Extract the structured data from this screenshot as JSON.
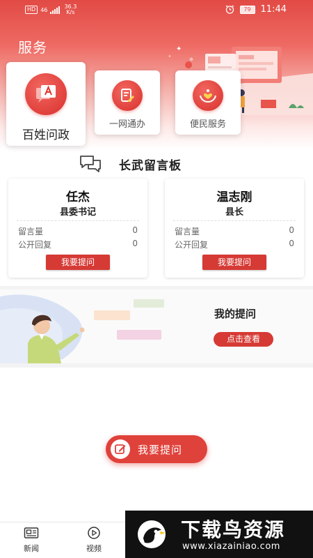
{
  "status_bar": {
    "left_badges": [
      "HD",
      "46"
    ],
    "net_speed_value": "36.3",
    "net_speed_unit": "K/s",
    "battery": "79",
    "time": "11:44"
  },
  "header": {
    "title": "服务"
  },
  "services": [
    {
      "label": "百姓问政",
      "icon": "chat-a-icon"
    },
    {
      "label": "一网通办",
      "icon": "document-edit-icon"
    },
    {
      "label": "便民服务",
      "icon": "hands-heart-icon"
    }
  ],
  "board": {
    "title": "长武留言板",
    "icon": "speech-bubbles-icon",
    "officials": [
      {
        "name": "任杰",
        "title": "县委书记",
        "stat1_label": "留言量",
        "stat1_value": "0",
        "stat2_label": "公开回复",
        "stat2_value": "0",
        "button": "我要提问"
      },
      {
        "name": "温志刚",
        "title": "县长",
        "stat1_label": "留言量",
        "stat1_value": "0",
        "stat2_label": "公开回复",
        "stat2_value": "0",
        "button": "我要提问"
      }
    ]
  },
  "my_questions": {
    "title": "我的提问",
    "button": "点击查看"
  },
  "ask_button": {
    "label": "我要提问",
    "icon": "edit-icon"
  },
  "bottom_nav": {
    "items": [
      {
        "label": "新闻",
        "icon": "newspaper-icon"
      },
      {
        "label": "视频",
        "icon": "play-icon"
      }
    ]
  },
  "watermark": {
    "title": "下载鸟资源",
    "url": "www.xiazainiao.com"
  },
  "colors": {
    "brand_red": "#d63a35",
    "header_gradient_top": "#e24a45"
  }
}
